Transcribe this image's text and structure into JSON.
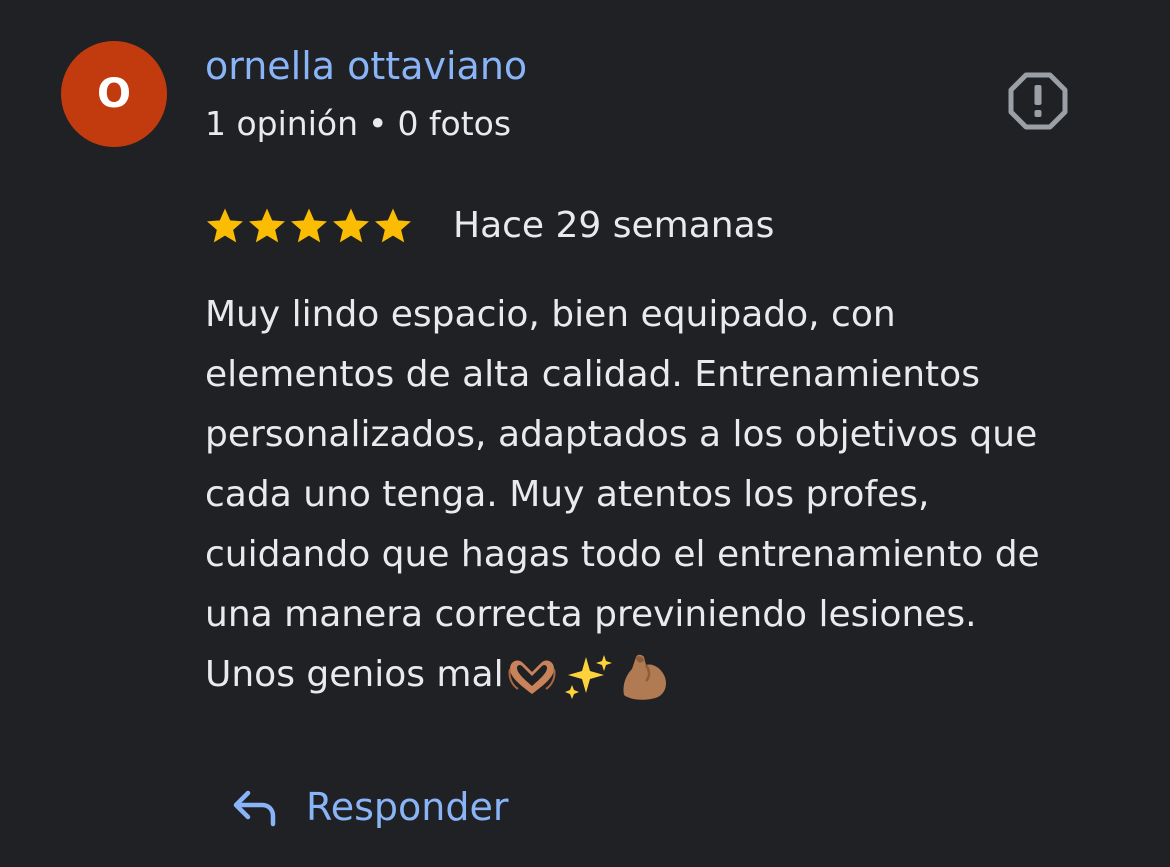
{
  "reviewer": {
    "initial": "O",
    "avatar_color": "#c23b0f",
    "name": "ornella ottaviano",
    "review_count": "1 opinión",
    "separator": "•",
    "photo_count": "0 fotos"
  },
  "report_icon": "report-flag-icon",
  "rating": {
    "stars": 5,
    "max_stars": 5,
    "star_color": "#fbbc04",
    "timestamp": "Hace 29 semanas"
  },
  "review": {
    "lines": [
      "Muy lindo espacio, bien equipado, con",
      "elementos de alta calidad. Entrenamientos",
      "personalizados, adaptados a los objetivos que",
      "cada uno tenga. Muy atentos los profes,",
      "cuidando que hagas todo el entrenamiento de",
      "una manera correcta previniendo lesiones.",
      "Unos genios mal"
    ],
    "emojis": [
      "heart-hands-emoji",
      "sparkles-emoji",
      "flexed-biceps-emoji"
    ]
  },
  "actions": {
    "reply_label": "Responder",
    "reply_icon": "reply-arrow-icon"
  },
  "colors": {
    "background": "#202124",
    "accent": "#8ab4f8",
    "text": "#e8eaed",
    "muted_icon": "#9aa0a6"
  }
}
